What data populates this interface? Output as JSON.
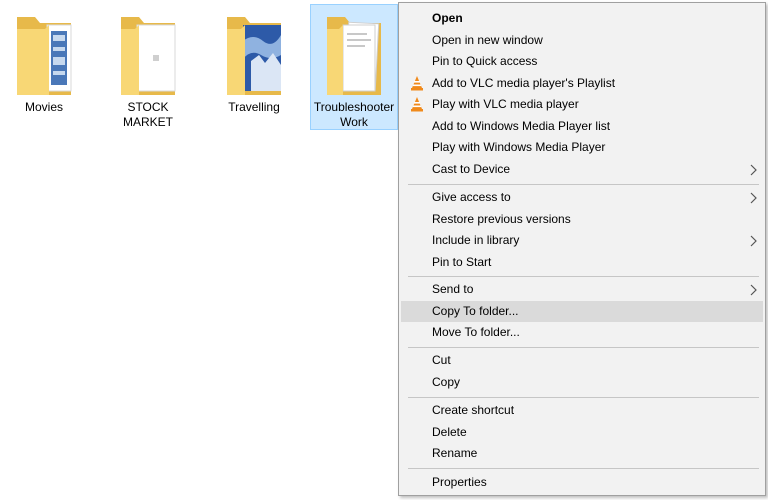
{
  "folders": [
    {
      "label": "Movies"
    },
    {
      "label": "STOCK MARKET"
    },
    {
      "label": "Travelling"
    },
    {
      "label": "Troubleshooter\nWork"
    }
  ],
  "menu": {
    "open": "Open",
    "open_new_window": "Open in new window",
    "pin_quick_access": "Pin to Quick access",
    "add_vlc_playlist": "Add to VLC media player's Playlist",
    "play_vlc": "Play with VLC media player",
    "add_wmp_list": "Add to Windows Media Player list",
    "play_wmp": "Play with Windows Media Player",
    "cast_to_device": "Cast to Device",
    "give_access": "Give access to",
    "restore_previous": "Restore previous versions",
    "include_library": "Include in library",
    "pin_start": "Pin to Start",
    "send_to": "Send to",
    "copy_to_folder": "Copy To folder...",
    "move_to_folder": "Move To folder...",
    "cut": "Cut",
    "copy": "Copy",
    "create_shortcut": "Create shortcut",
    "delete": "Delete",
    "rename": "Rename",
    "properties": "Properties"
  },
  "icons": {
    "folder": "folder-icon",
    "vlc": "vlc-cone-icon",
    "submenu": "chevron-right-icon"
  },
  "colors": {
    "selection_bg": "#cce8ff",
    "menu_bg": "#f2f2f2",
    "menu_highlight": "#dadada",
    "folder_yellow": "#f8d775",
    "vlc_orange": "#f08a1c"
  }
}
